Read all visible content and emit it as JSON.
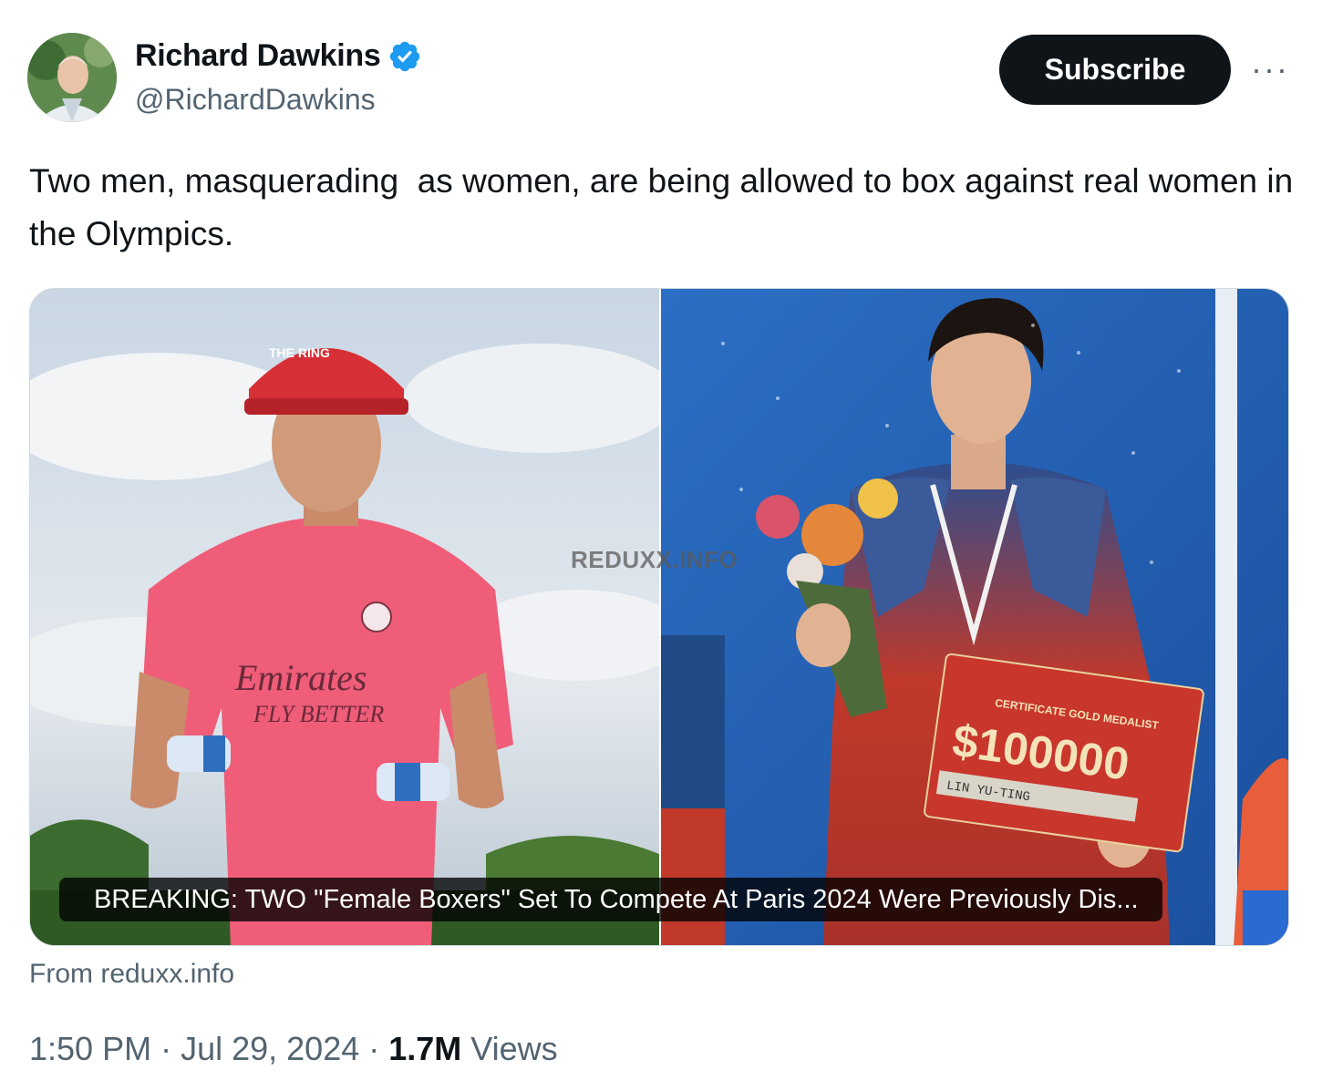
{
  "author": {
    "display_name": "Richard Dawkins",
    "handle": "@RichardDawkins",
    "verified_color": "#1d9bf0"
  },
  "actions": {
    "subscribe_label": "Subscribe",
    "more_label": "···"
  },
  "tweet": {
    "text": "Two men, masquerading  as women, are being allowed to box against real women in the Olympics."
  },
  "card": {
    "caption": "BREAKING: TWO \"Female Boxers\" Set To Compete At Paris 2024 Were Previously Dis...",
    "watermark": "REDUXX.INFO",
    "left_image": {
      "cap_text": "THE RING",
      "shirt_text_1": "Emirates",
      "shirt_text_2": "FLY BETTER"
    },
    "right_image": {
      "check_amount": "$100000",
      "check_line": "CERTIFICATE GOLD MEDALIST",
      "check_name": "LIN YU-TING"
    },
    "source": "From reduxx.info"
  },
  "meta": {
    "time": "1:50 PM",
    "separator": " · ",
    "date": "Jul 29, 2024",
    "views_count": "1.7M",
    "views_label": " Views"
  }
}
